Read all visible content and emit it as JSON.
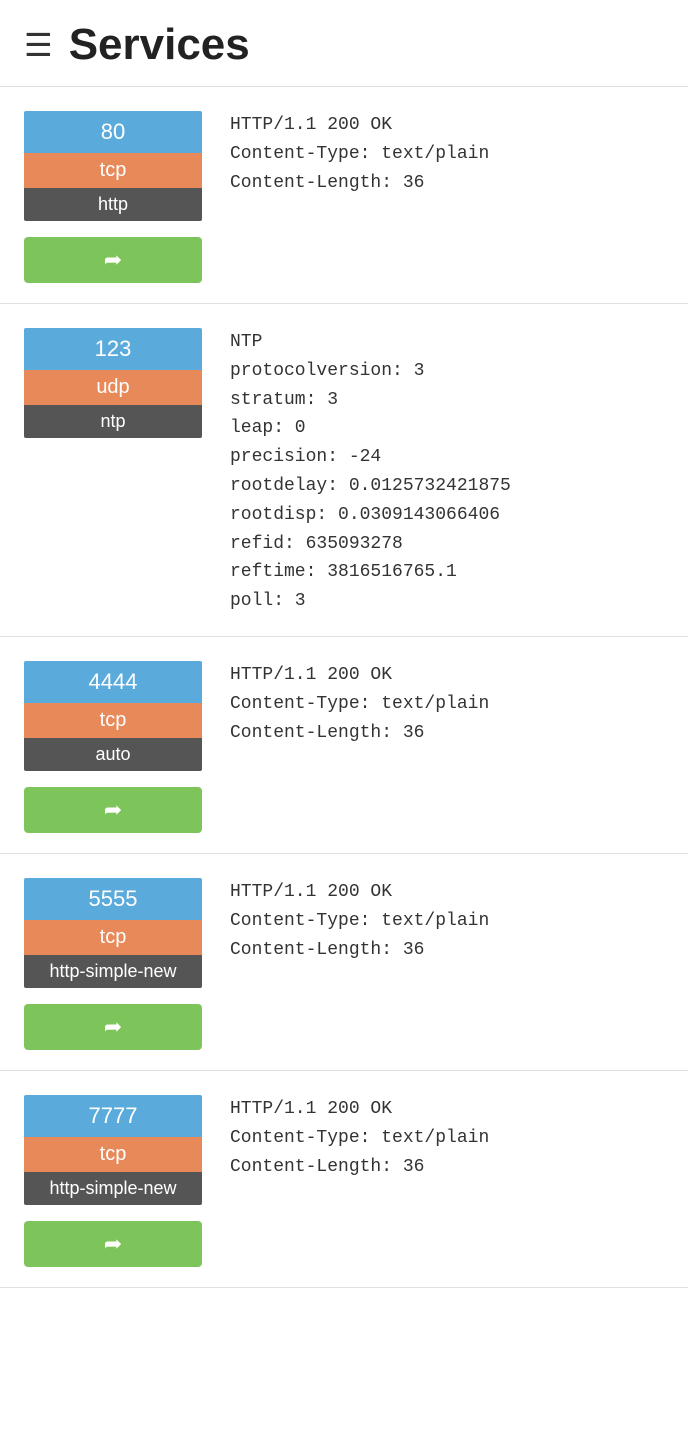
{
  "header": {
    "title": "Services",
    "icon": "≡"
  },
  "services": [
    {
      "id": "service-80",
      "port": "80",
      "protocol": "tcp",
      "service_name": "http",
      "response": "HTTP/1.1 200 OK\nContent-Type: text/plain\nContent-Length: 36",
      "has_action": true,
      "action_label": "→"
    },
    {
      "id": "service-123",
      "port": "123",
      "protocol": "udp",
      "service_name": "ntp",
      "response": "NTP\nprotocolversion: 3\nstratum: 3\nleap: 0\nprecision: -24\nrootdelay: 0.0125732421875\nrootdisp: 0.0309143066406\nrefid: 635093278\nreftime: 3816516765.1\npoll: 3",
      "has_action": false,
      "action_label": ""
    },
    {
      "id": "service-4444",
      "port": "4444",
      "protocol": "tcp",
      "service_name": "auto",
      "response": "HTTP/1.1 200 OK\nContent-Type: text/plain\nContent-Length: 36",
      "has_action": true,
      "action_label": "→"
    },
    {
      "id": "service-5555",
      "port": "5555",
      "protocol": "tcp",
      "service_name": "http-simple-new",
      "response": "HTTP/1.1 200 OK\nContent-Type: text/plain\nContent-Length: 36",
      "has_action": true,
      "action_label": "→"
    },
    {
      "id": "service-7777",
      "port": "7777",
      "protocol": "tcp",
      "service_name": "http-simple-new",
      "response": "HTTP/1.1 200 OK\nContent-Type: text/plain\nContent-Length: 36",
      "has_action": true,
      "action_label": "→"
    }
  ]
}
